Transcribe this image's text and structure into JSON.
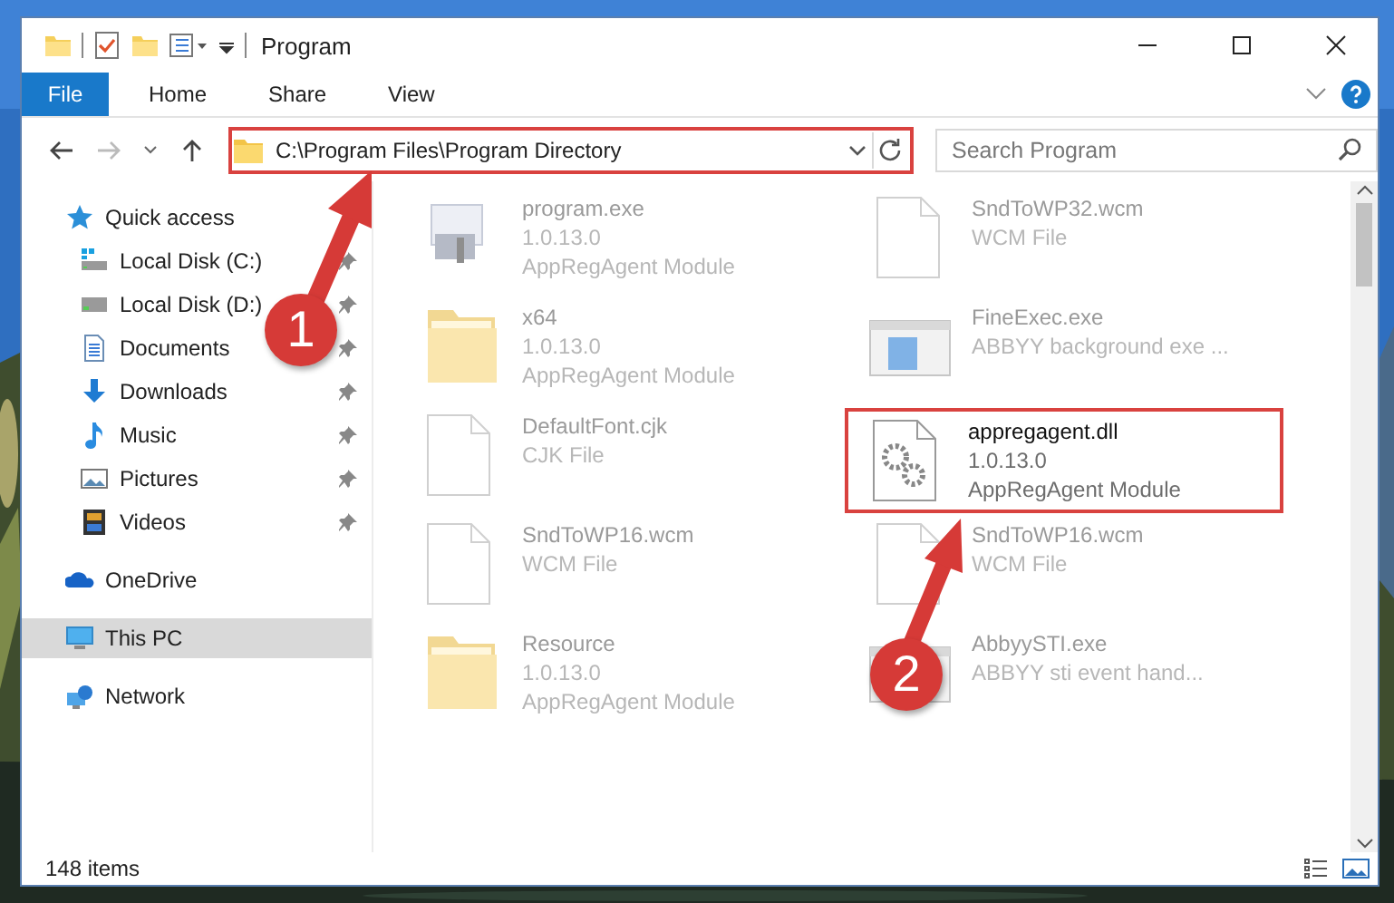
{
  "window": {
    "title": "Program"
  },
  "ribbon_tabs": [
    {
      "label": "File",
      "kind": "file"
    },
    {
      "label": "Home",
      "kind": "tab"
    },
    {
      "label": "Share",
      "kind": "tab"
    },
    {
      "label": "View",
      "kind": "tab"
    }
  ],
  "address_bar": {
    "path": "C:\\Program Files\\Program Directory",
    "highlighted": true
  },
  "search": {
    "placeholder": "Search Program"
  },
  "sidebar": {
    "items": [
      {
        "label": "Quick access",
        "kind": "star",
        "selected": false,
        "children": [
          {
            "label": "Local Disk (C:)",
            "kind": "system-drive",
            "pinned": true,
            "selected": false
          },
          {
            "label": "Local Disk (D:)",
            "kind": "drive",
            "pinned": true,
            "selected": false
          },
          {
            "label": "Documents",
            "kind": "documents",
            "pinned": true,
            "selected": false
          },
          {
            "label": "Downloads",
            "kind": "downloads",
            "pinned": true,
            "selected": false
          },
          {
            "label": "Music",
            "kind": "music",
            "pinned": true,
            "selected": false
          },
          {
            "label": "Pictures",
            "kind": "pictures",
            "pinned": true,
            "selected": false
          },
          {
            "label": "Videos",
            "kind": "videos",
            "pinned": true,
            "selected": false
          }
        ]
      },
      {
        "label": "OneDrive",
        "kind": "cloud",
        "selected": false
      },
      {
        "label": "This PC",
        "kind": "pc",
        "selected": true
      },
      {
        "label": "Network",
        "kind": "network",
        "selected": false
      }
    ]
  },
  "files": [
    {
      "name": "program.exe",
      "details": [
        "1.0.13.0",
        "AppRegAgent Module"
      ],
      "kind": "app",
      "faded": true,
      "highlighted": false
    },
    {
      "name": "SndToWP32.wcm",
      "details": [
        "WCM File"
      ],
      "kind": "file",
      "faded": true,
      "highlighted": false
    },
    {
      "name": "x64",
      "details": [
        "1.0.13.0",
        "AppRegAgent Module"
      ],
      "kind": "folder",
      "faded": true,
      "highlighted": false
    },
    {
      "name": "FineExec.exe",
      "details": [
        "ABBYY background exe ..."
      ],
      "kind": "window",
      "faded": true,
      "highlighted": false
    },
    {
      "name": "DefaultFont.cjk",
      "details": [
        "CJK File"
      ],
      "kind": "file",
      "faded": true,
      "highlighted": false
    },
    {
      "name": "appregagent.dll",
      "details": [
        "1.0.13.0",
        "AppRegAgent Module"
      ],
      "kind": "dll",
      "faded": false,
      "highlighted": true
    },
    {
      "name": "SndToWP16.wcm",
      "details": [
        "WCM File"
      ],
      "kind": "file",
      "faded": true,
      "highlighted": false
    },
    {
      "name": "SndToWP16.wcm",
      "details": [
        "WCM File"
      ],
      "kind": "file",
      "faded": true,
      "highlighted": false
    },
    {
      "name": "Resource",
      "details": [
        "1.0.13.0",
        "AppRegAgent Module"
      ],
      "kind": "folder",
      "faded": true,
      "highlighted": false
    },
    {
      "name": "AbbyySTI.exe",
      "details": [
        "ABBYY sti event hand..."
      ],
      "kind": "window",
      "faded": true,
      "highlighted": false
    }
  ],
  "status_bar": {
    "count": "148 items"
  },
  "annotations": [
    {
      "label": "1"
    },
    {
      "label": "2"
    }
  ]
}
